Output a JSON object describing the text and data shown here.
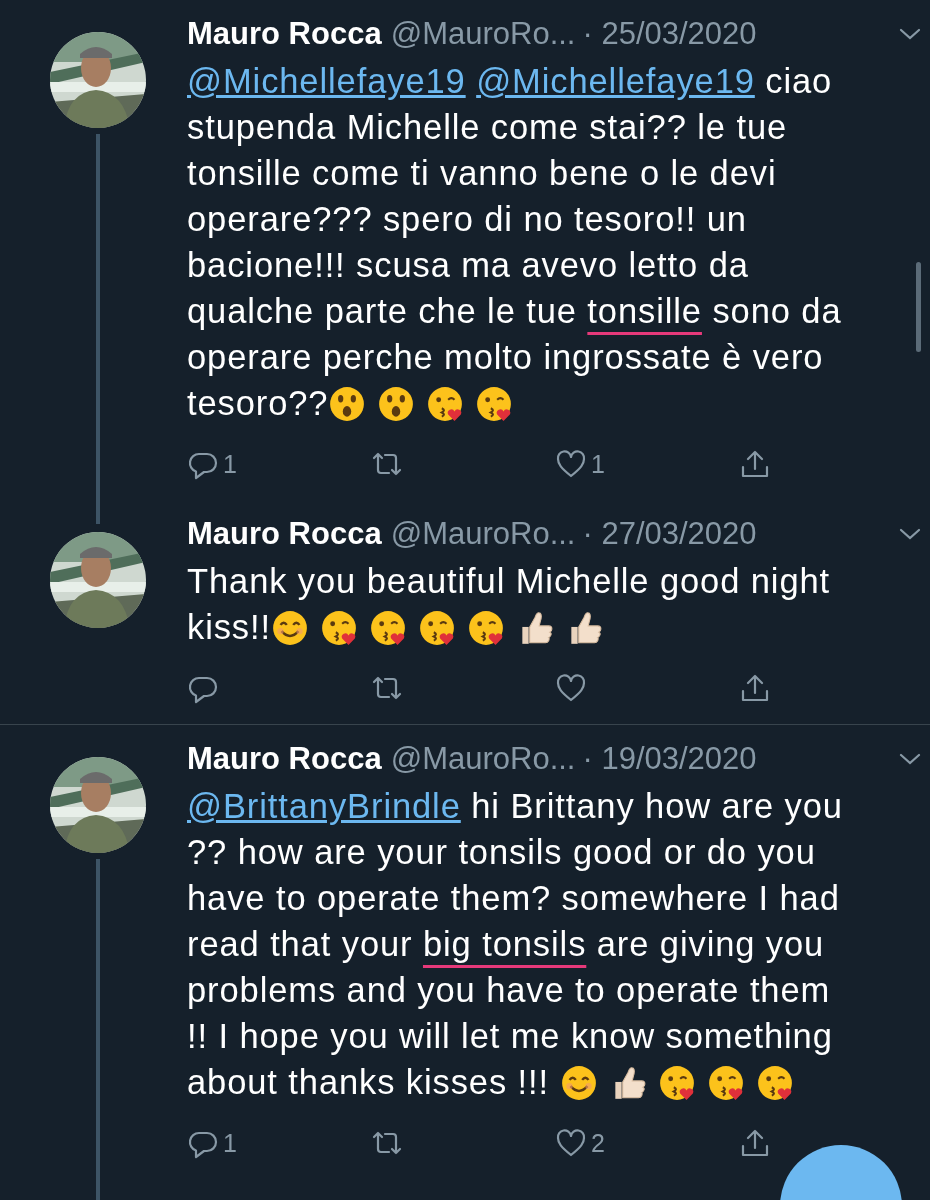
{
  "conversations": [
    {
      "tweets": [
        {
          "name": "Mauro Rocca",
          "handle": "@MauroRo...",
          "date": "· 25/03/2020",
          "thread_below": true,
          "segments": [
            {
              "kind": "mention",
              "text": "@Michellefaye19"
            },
            {
              "kind": "mention",
              "text": "@Michellefaye19"
            },
            {
              "kind": "text",
              "text": " ciao stupenda Michelle come stai?? le tue tonsille come ti vanno bene o le devi operare??? spero di no tesoro!! un bacione!!! scusa ma avevo letto da qualche parte che le tue "
            },
            {
              "kind": "underlined",
              "text": "tonsille"
            },
            {
              "kind": "text",
              "text": " sono da operare perche molto ingrossate è vero tesoro??"
            },
            {
              "kind": "astonished_emoji"
            },
            {
              "kind": "astonished_emoji"
            },
            {
              "kind": "kiss_emoji"
            },
            {
              "kind": "kiss_emoji"
            }
          ],
          "actions": [
            {
              "kind": "reply",
              "count": "1"
            },
            {
              "kind": "retweet"
            },
            {
              "kind": "like",
              "count": "1"
            },
            {
              "kind": "share"
            }
          ]
        },
        {
          "name": "Mauro Rocca",
          "handle": "@MauroRo...",
          "date": "· 27/03/2020",
          "thread_below": false,
          "segments": [
            {
              "kind": "text",
              "text": "Thank you beautiful Michelle good night kiss!!"
            },
            {
              "kind": "smile_emoji"
            },
            {
              "kind": "kiss_emoji"
            },
            {
              "kind": "kiss_emoji"
            },
            {
              "kind": "kiss_emoji"
            },
            {
              "kind": "kiss_emoji"
            },
            {
              "kind": "thumbs_up_emoji"
            },
            {
              "kind": "thumbs_up_emoji"
            }
          ],
          "actions": [
            {
              "kind": "reply"
            },
            {
              "kind": "retweet"
            },
            {
              "kind": "like"
            },
            {
              "kind": "share"
            }
          ]
        }
      ]
    },
    {
      "tweets": [
        {
          "name": "Mauro Rocca",
          "handle": "@MauroRo...",
          "date": "· 19/03/2020",
          "thread_below": true,
          "segments": [
            {
              "kind": "mention",
              "text": "@BrittanyBrindle"
            },
            {
              "kind": "text",
              "text": " hi Brittany how are you ?? how are your tonsils good or do you have to operate them?  somewhere I had read that your "
            },
            {
              "kind": "underlined",
              "text": "big tonsils"
            },
            {
              "kind": "text",
              "text": " are giving you problems and you have to operate them !! I hope you will let me know something about thanks kisses !!! "
            },
            {
              "kind": "smile_emoji"
            },
            {
              "kind": "thumbs_up_emoji"
            },
            {
              "kind": "kiss_emoji"
            },
            {
              "kind": "kiss_emoji"
            },
            {
              "kind": "kiss_emoji"
            }
          ],
          "actions": [
            {
              "kind": "reply",
              "count": "1"
            },
            {
              "kind": "retweet"
            },
            {
              "kind": "like",
              "count": "2"
            },
            {
              "kind": "share"
            }
          ]
        }
      ]
    }
  ]
}
